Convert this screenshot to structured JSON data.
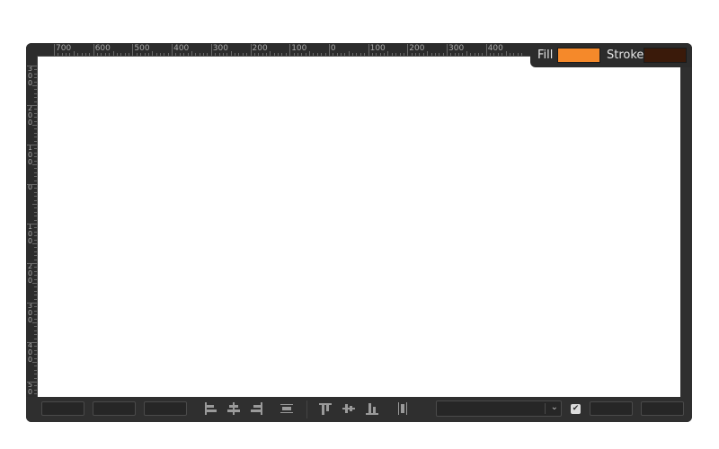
{
  "ruler": {
    "horizontal_labels": [
      "700",
      "600",
      "500",
      "400",
      "300",
      "200",
      "100",
      "0",
      "100",
      "200",
      "300",
      "400"
    ],
    "vertical_labels": [
      "3\n0\n0",
      "2\n0\n0",
      "1\n0\n0",
      "0",
      "1\n0\n0",
      "2\n0\n0",
      "3\n0\n0",
      "4\n0\n0",
      "5\n0"
    ]
  },
  "colors": {
    "fill_label": "Fill",
    "stroke_label": "Stroke",
    "fill_color": "#f5892a",
    "stroke_color": "#3a1a0a"
  },
  "toolbar": {
    "field_x": "",
    "field_y": "",
    "field_w": "",
    "dropdown_value": "",
    "snap_checked": true,
    "field_a": "",
    "field_b": "",
    "icons": [
      "align-left-icon",
      "align-center-h-icon",
      "align-right-icon",
      "distribute-h-icon",
      "align-top-icon",
      "align-middle-v-icon",
      "align-bottom-icon",
      "distribute-v-icon",
      "chevron-down-icon",
      "checkbox-checked-icon"
    ]
  }
}
